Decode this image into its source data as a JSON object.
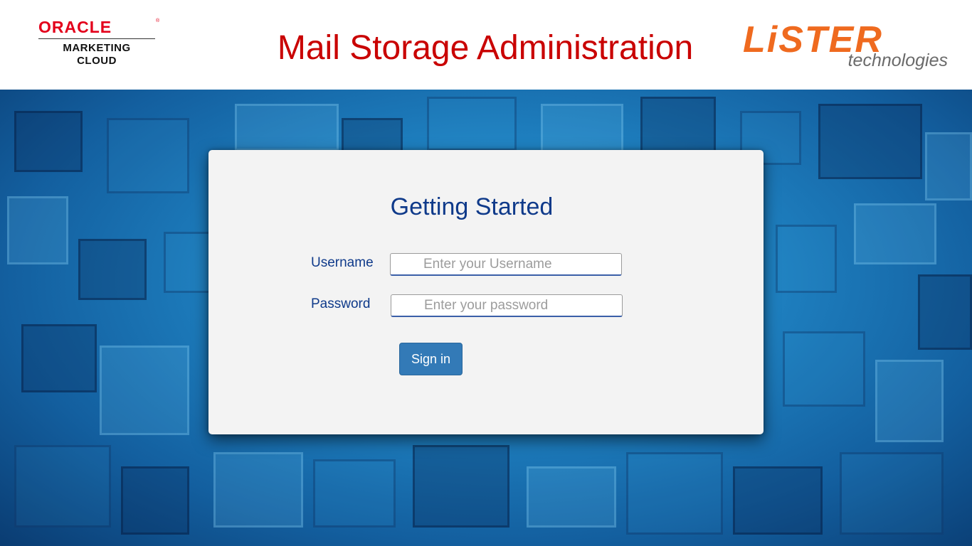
{
  "header": {
    "oracle_logo": {
      "wordmark": "ORACLE",
      "registered": "®",
      "line1": "MARKETING",
      "line2": "CLOUD"
    },
    "title": "Mail Storage Administration",
    "lister_logo": {
      "wordmark": "LiSTER",
      "tagline": "technologies"
    }
  },
  "login": {
    "heading": "Getting Started",
    "username": {
      "label": "Username",
      "placeholder": "Enter your Username",
      "value": ""
    },
    "password": {
      "label": "Password",
      "placeholder": "Enter your password",
      "value": ""
    },
    "submit_label": "Sign in"
  },
  "colors": {
    "title_red": "#c90000",
    "oracle_red": "#e3001b",
    "lister_orange": "#ef6a1f",
    "heading_blue": "#0f3a8a",
    "button_blue": "#337ab7"
  }
}
